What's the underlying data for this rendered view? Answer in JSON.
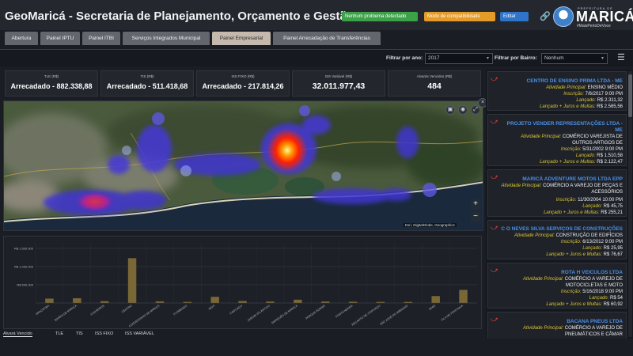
{
  "header": {
    "title": "GeoMaricá - Secretaria de Planejamento, Orçamento e Gestão",
    "status_ok": "Nenhum problema detectado",
    "status_compat": "Modo de compatibilidade",
    "edit_label": "Editar",
    "logo": {
      "top": "PREFEITURA DE",
      "name": "MARICÁ",
      "tagline": "#MaisPertoDeVoce"
    }
  },
  "tabs": [
    {
      "label": "Abertura",
      "active": false
    },
    {
      "label": "Painel IPTU",
      "active": false
    },
    {
      "label": "Painel ITBI",
      "active": false
    },
    {
      "label": "Serviços Integrados Municipal",
      "active": false
    },
    {
      "label": "Painel Empresarial",
      "active": true
    },
    {
      "label": "Painel Arrecadação de Transferências",
      "active": false
    }
  ],
  "filters": {
    "ano_label": "Filtrar por ano:",
    "ano_value": "2017",
    "bairro_label": "Filtrar por Bairro:",
    "bairro_value": "Nenhum"
  },
  "kpis": [
    {
      "label": "TLE (R$)",
      "value": "Arrecadado - 882.338,88"
    },
    {
      "label": "TIS (R$)",
      "value": "Arrecadado - 511.418,68"
    },
    {
      "label": "ISS FIXO (R$)",
      "value": "Arrecadado - 217.814,26"
    },
    {
      "label": "ISS Variável (R$)",
      "value": "32.011.977,43"
    },
    {
      "label": "Alvarás Vencidos (R$)",
      "value": "484"
    }
  ],
  "map": {
    "attribution": "Esri, DigitalGlobe, Geographics"
  },
  "chart_data": {
    "type": "bar",
    "title": "",
    "xlabel": "",
    "ylabel": "",
    "y_ticks": [
      "R$ 1.500.000",
      "R$ 1.000.000",
      "R$ 500.000"
    ],
    "ylim": [
      0,
      1650000
    ],
    "categories": [
      "ARAÇATIBA",
      "BARRA DE MARICÁ",
      "CAJUEIROS",
      "CENTRO",
      "CORDEIRINHO DE MARICÁ",
      "FLAMENGO",
      "INOÁ",
      "ITAIPUAÇU",
      "JARDIM ATLÂNTICO",
      "MARQUÊS DE MARICÁ",
      "PARQUE ROMAR",
      "PONTA NEGRA",
      "RECANTO DE ITAIPUAÇU",
      "SÃO JOSÉ DO IMBASSAÍ",
      "SPAR",
      "VILA DE PONTINHA"
    ],
    "values": [
      120000,
      130000,
      50000,
      1230000,
      45000,
      30000,
      170000,
      55000,
      40000,
      90000,
      40000,
      35000,
      30000,
      30000,
      190000,
      360000
    ],
    "bar_color": "#7a6736"
  },
  "chart_tabs": [
    {
      "label": "Alvará Vencido",
      "active": true
    },
    {
      "label": "TLE",
      "active": false
    },
    {
      "label": "TIS",
      "active": false
    },
    {
      "label": "ISS FIXO",
      "active": false
    },
    {
      "label": "ISS VARIÁVEL",
      "active": false
    }
  ],
  "companies": [
    {
      "name": "CENTRO DE ENSINO PRIMA LTDA - ME",
      "activity_label": "Atividade Principal:",
      "activity": "ENSINO MÉDIO",
      "inscricao_label": "Inscrição:",
      "inscricao": "7/6/2017 9:00 PM",
      "lancado_label": "Lançado:",
      "lancado": "R$ 2.311,32",
      "juros_label": "Lançado + Juros e Multas:",
      "juros": "R$ 2.565,56"
    },
    {
      "name": "PROJETO VENDER REPRESENTAÇÕES LTDA - ME",
      "activity_label": "Atividade Principal:",
      "activity": "COMÉRCIO VAREJISTA DE OUTROS ARTIGOS DE",
      "inscricao_label": "Inscrição:",
      "inscricao": "5/31/2002 9:00 PM",
      "lancado_label": "Lançado:",
      "lancado": "R$ 1.510,58",
      "juros_label": "Lançado + Juros e Multas:",
      "juros": "R$ 2.122,47"
    },
    {
      "name": "MARICÁ ADVENTURE MOTOS LTDA EPP",
      "activity_label": "Atividade Principal:",
      "activity": "COMÉRCIO A VAREJO DE PEÇAS E ACESSÓRIOS",
      "inscricao_label": "Inscrição:",
      "inscricao": "11/30/2004 10:00 PM",
      "lancado_label": "Lançado:",
      "lancado": "R$ 45,75",
      "juros_label": "Lançado + Juros e Multas:",
      "juros": "R$ 255,21"
    },
    {
      "name": "C O NEVES SILVA SERVIÇOS DE CONSTRUÇÕES",
      "activity_label": "Atividade Principal:",
      "activity": "CONSTRUÇÃO DE EDIFÍCIOS",
      "inscricao_label": "Inscrição:",
      "inscricao": "6/13/2012 9:00 PM",
      "lancado_label": "Lançado:",
      "lancado": "R$ 25,95",
      "juros_label": "Lançado + Juros e Multas:",
      "juros": "R$ 76,67"
    },
    {
      "name": "ROTA H VEICULOS LTDA",
      "activity_label": "Atividade Principal:",
      "activity": "COMÉRCIO A VAREJO DE MOTOCICLETAS E MOTO",
      "inscricao_label": "Inscrição:",
      "inscricao": "5/16/2018 9:00 PM",
      "lancado_label": "Lançado:",
      "lancado": "R$ 54",
      "juros_label": "Lançado + Juros e Multas:",
      "juros": "R$ 60,92"
    },
    {
      "name": "BACANA PNEUS LTDA",
      "activity_label": "Atividade Principal:",
      "activity": "COMÉRCIO A VAREJO DE PNEUMÁTICOS E CÂMAR",
      "inscricao_label": "",
      "inscricao": "",
      "lancado_label": "",
      "lancado": "",
      "juros_label": "",
      "juros": ""
    }
  ]
}
